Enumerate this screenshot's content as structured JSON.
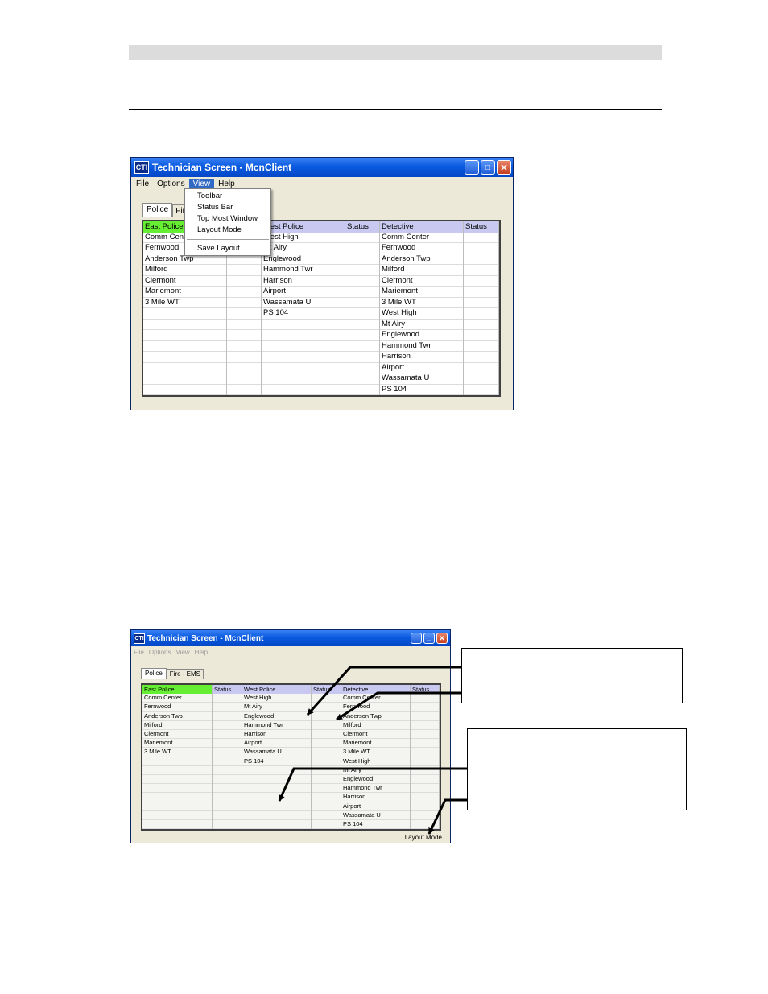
{
  "screen1": {
    "title": "Technician Screen - McnClient",
    "icon_label": "CTI",
    "menu": [
      "File",
      "Options",
      "View",
      "Help"
    ],
    "active_menu": "View",
    "tabs": [
      "Police",
      "Fire"
    ],
    "view_menu": [
      "Toolbar",
      "Status Bar",
      "Top Most Window",
      "Layout Mode",
      "Save Layout"
    ],
    "columns": [
      {
        "header": "East Police",
        "rows": [
          "Comm Center",
          "Fernwood",
          "Anderson Twp",
          "Milford",
          "Clermont",
          "Mariemont",
          "3 Mile WT"
        ]
      },
      {
        "header": "",
        "rows": []
      },
      {
        "header": "West Police",
        "rows": [
          "West High",
          "Mt Airy",
          "Englewood",
          "Hammond Twr",
          "Harrison",
          "Airport",
          "Wassamata U",
          "PS 104"
        ]
      },
      {
        "header": "Status",
        "rows": []
      },
      {
        "header": "Detective",
        "rows": [
          "Comm Center",
          "Fernwood",
          "Anderson Twp",
          "Milford",
          "Clermont",
          "Mariemont",
          "3 Mile WT",
          "West High",
          "Mt Airy",
          "Englewood",
          "Hammond Twr",
          "Harrison",
          "Airport",
          "Wassamata U",
          "PS 104"
        ]
      },
      {
        "header": "Status",
        "rows": []
      }
    ]
  },
  "screen2": {
    "title": "Technician Screen - McnClient",
    "icon_label": "CTI",
    "menu": [
      "File",
      "Options",
      "View",
      "Help"
    ],
    "tabs": [
      "Police",
      "Fire - EMS"
    ],
    "columns": [
      {
        "header": "East Police",
        "rows": [
          "Comm Center",
          "Fernwood",
          "Anderson Twp",
          "Milford",
          "Clermont",
          "Mariemont",
          "3 Mile WT"
        ]
      },
      {
        "header": "Status",
        "rows": []
      },
      {
        "header": "West Police",
        "rows": [
          "West High",
          "Mt Airy",
          "Englewood",
          "Hammond Twr",
          "Harrison",
          "Airport",
          "Wassamata U",
          "PS 104"
        ]
      },
      {
        "header": "Status",
        "rows": []
      },
      {
        "header": "Detective",
        "rows": [
          "Comm Center",
          "Fernwood",
          "Anderson Twp",
          "Milford",
          "Clermont",
          "Mariemont",
          "3 Mile WT",
          "West High",
          "Mt Airy",
          "Englewood",
          "Hammond Twr",
          "Harrison",
          "Airport",
          "Wassamata U",
          "PS 104"
        ]
      },
      {
        "header": "Status",
        "rows": []
      }
    ],
    "status_bar": "Layout Mode"
  },
  "colors": {
    "title_blue": "#0a5ae0",
    "header_green": "#66ee33",
    "header_lavender": "#c8c8f0",
    "menu_highlight": "#316ac5"
  }
}
